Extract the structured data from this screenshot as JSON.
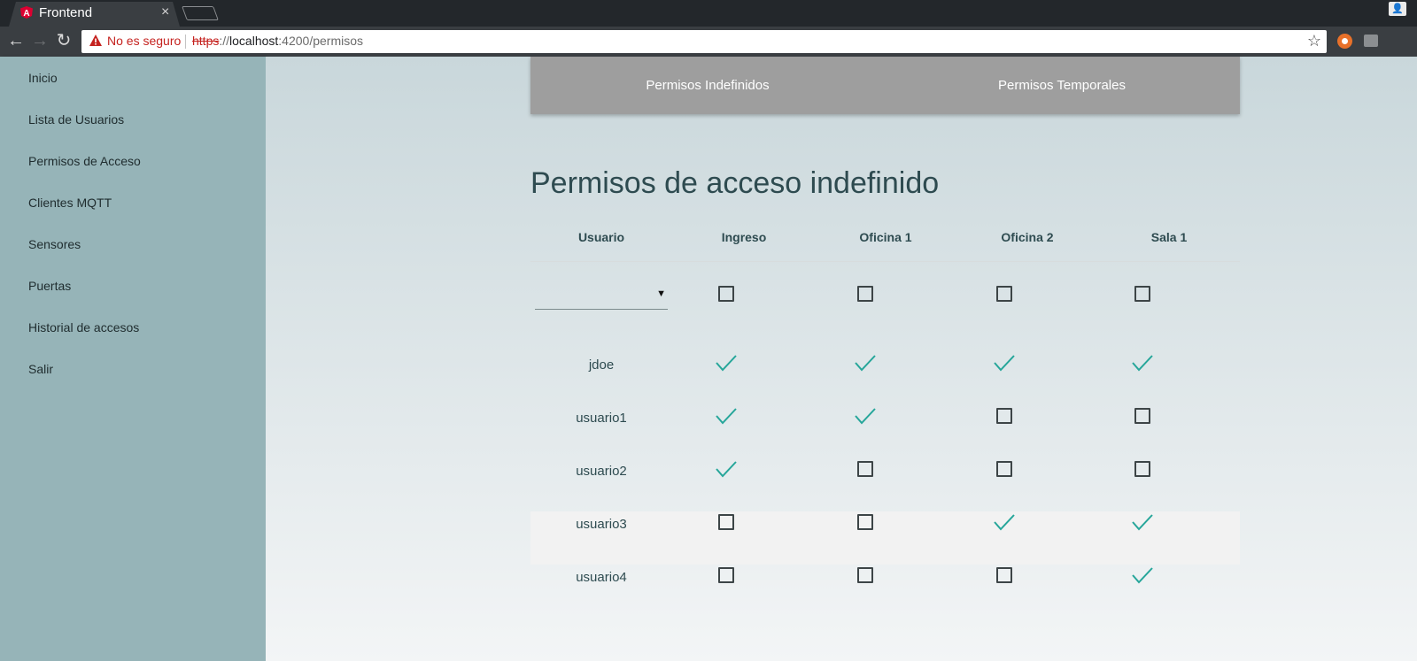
{
  "browser": {
    "tab_title": "Frontend",
    "tab_close": "×",
    "security_text": "No es seguro",
    "url_scheme": "https",
    "url_sep": "://",
    "url_host": "localhost",
    "url_rest": ":4200/permisos",
    "star": "☆",
    "menu": "⋮",
    "back": "←",
    "forward": "→",
    "reload": "↻",
    "profile": "👤",
    "accent_warning": "#c5221f"
  },
  "sidebar": {
    "items": [
      {
        "label": "Inicio"
      },
      {
        "label": "Lista de Usuarios"
      },
      {
        "label": "Permisos de Acceso"
      },
      {
        "label": "Clientes MQTT"
      },
      {
        "label": "Sensores"
      },
      {
        "label": "Puertas"
      },
      {
        "label": "Historial de accesos"
      },
      {
        "label": "Salir"
      }
    ]
  },
  "tabs": [
    {
      "label": "Permisos Indefinidos"
    },
    {
      "label": "Permisos Temporales"
    }
  ],
  "main": {
    "title": "Permisos de acceso indefinido",
    "columns": [
      "Usuario",
      "Ingreso",
      "Oficina 1",
      "Oficina 2",
      "Sala 1"
    ],
    "new_row": {
      "selected_user": "",
      "select_arrow": "▼",
      "checks": [
        false,
        false,
        false,
        false
      ]
    },
    "rows": [
      {
        "user": "jdoe",
        "checks": [
          true,
          true,
          true,
          true
        ]
      },
      {
        "user": "usuario1",
        "checks": [
          true,
          true,
          false,
          false
        ]
      },
      {
        "user": "usuario2",
        "checks": [
          true,
          false,
          false,
          false
        ]
      },
      {
        "user": "usuario3",
        "checks": [
          false,
          false,
          true,
          true
        ],
        "highlighted": true
      },
      {
        "user": "usuario4",
        "checks": [
          false,
          false,
          false,
          true
        ]
      }
    ],
    "check_color": "#26a69a"
  }
}
